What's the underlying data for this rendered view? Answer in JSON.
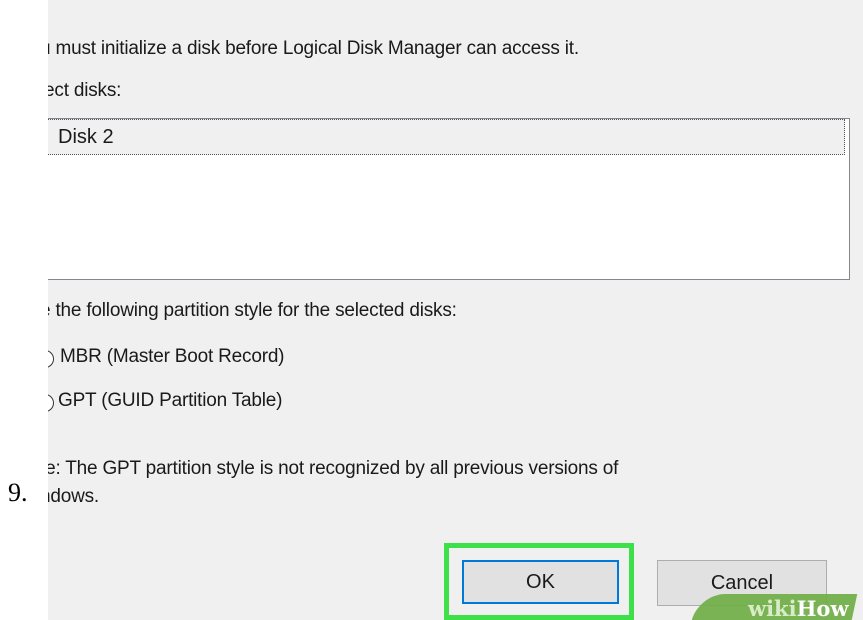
{
  "step_number": "9.",
  "dialog": {
    "instruction": "u must initialize a disk before Logical Disk Manager can access it.",
    "select_label": "lect disks:",
    "disks": [
      "Disk 2"
    ],
    "partition_prompt": "e the following partition style for the selected disks:",
    "options": [
      {
        "label": "MBR (Master Boot Record)"
      },
      {
        "label": "GPT (GUID Partition Table)"
      }
    ],
    "note_line1": "te: The GPT partition style is not recognized by all previous versions of",
    "note_line2": "ndows.",
    "ok_label": "OK",
    "cancel_label": "Cancel",
    "highlight_color": "#3ee04a"
  },
  "watermark": {
    "part1": "wiki",
    "part2": "How",
    "color": "#6fae45"
  }
}
